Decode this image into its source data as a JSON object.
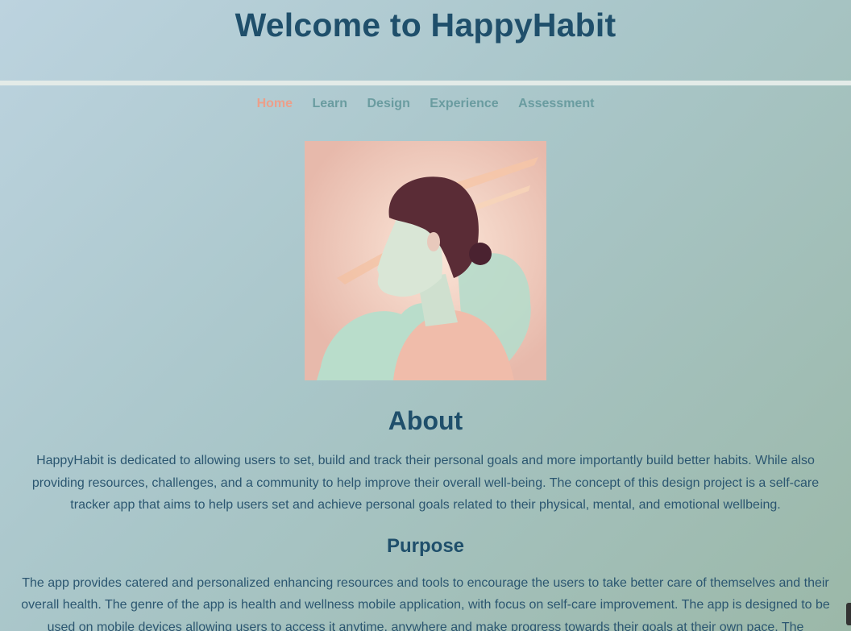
{
  "header": {
    "title": "Welcome to HappyHabit"
  },
  "nav": {
    "items": [
      {
        "label": "Home",
        "active": true
      },
      {
        "label": "Learn",
        "active": false
      },
      {
        "label": "Design",
        "active": false
      },
      {
        "label": "Experience",
        "active": false
      },
      {
        "label": "Assessment",
        "active": false
      }
    ]
  },
  "hero": {
    "image_alt": "Illustration of a woman in profile with pastel pink and mint background"
  },
  "about": {
    "title": "About",
    "text": "HappyHabit is dedicated to allowing users to set, build and track their personal goals and more importantly build better habits. While also providing resources, challenges, and a community to help improve their overall well-being. The concept of this design project is a self-care tracker app that aims to help users set and achieve personal goals related to their physical, mental, and emotional wellbeing."
  },
  "purpose": {
    "title": "Purpose",
    "text": "The app provides catered and personalized enhancing resources and tools to encourage the users to take better care of themselves and their overall health. The genre of the app is health and wellness mobile application, with focus on self-care improvement. The app is designed to be used on mobile devices allowing users to access it anytime, anywhere and make progress towards their goals at their own pace. The"
  },
  "colors": {
    "title": "#1f4f6b",
    "nav_active": "#ec9f8a",
    "nav_inactive": "#6a9ca0",
    "rule": "#e3ebe8"
  }
}
